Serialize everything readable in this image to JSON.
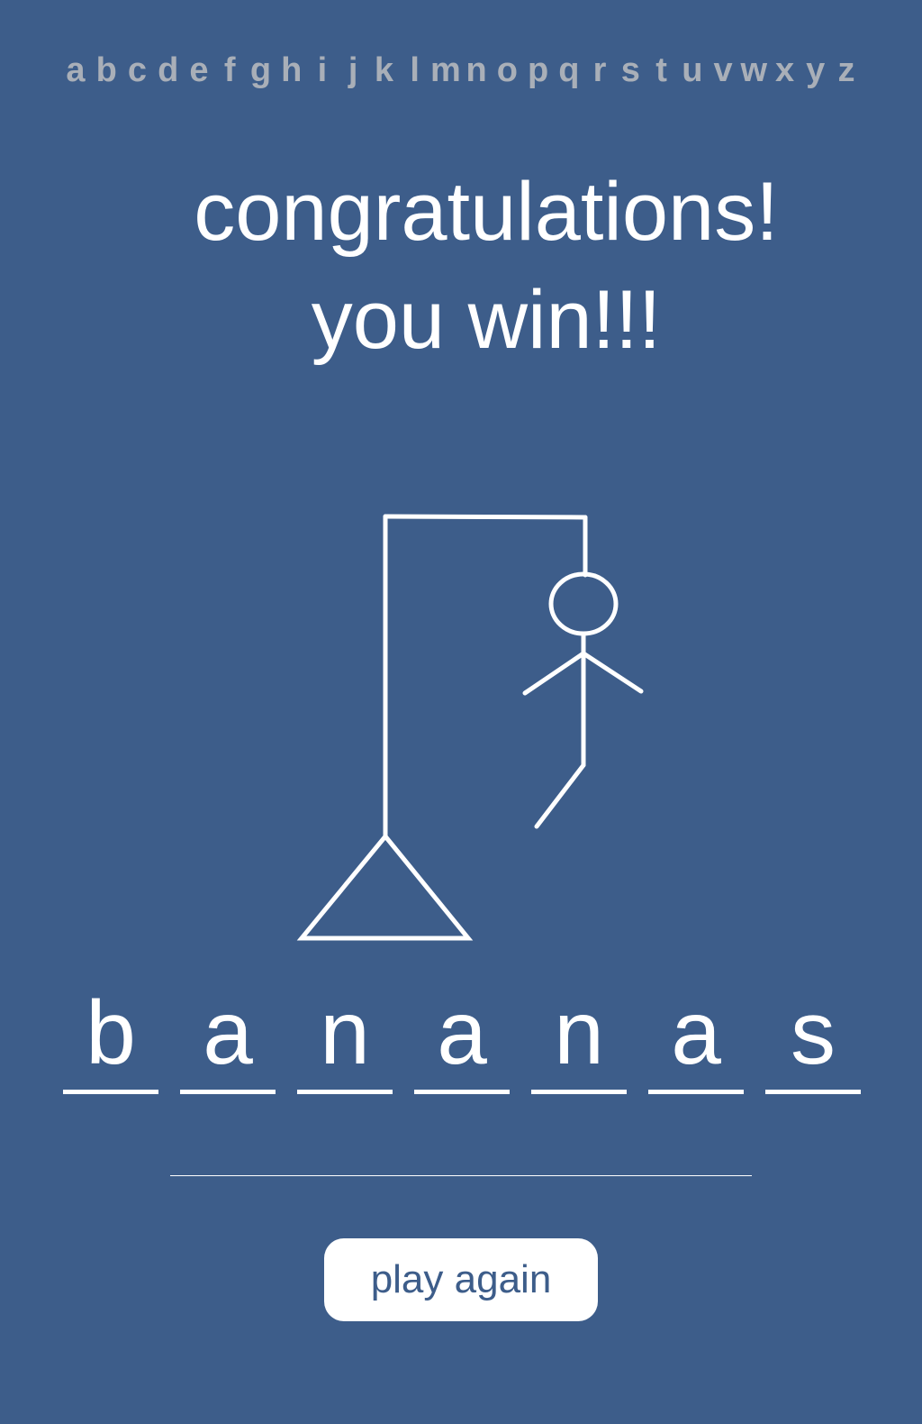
{
  "alphabet": [
    "a",
    "b",
    "c",
    "d",
    "e",
    "f",
    "g",
    "h",
    "i",
    "j",
    "k",
    "l",
    "m",
    "n",
    "o",
    "p",
    "q",
    "r",
    "s",
    "t",
    "u",
    "v",
    "w",
    "x",
    "y",
    "z"
  ],
  "message": {
    "line1": "congratulations!",
    "line2": "you win!!!"
  },
  "word": [
    "b",
    "a",
    "n",
    "a",
    "n",
    "a",
    "s"
  ],
  "play_again_label": "play again",
  "colors": {
    "background": "#3d5d8a",
    "used_letter": "#a9afb8",
    "foreground": "#ffffff"
  }
}
